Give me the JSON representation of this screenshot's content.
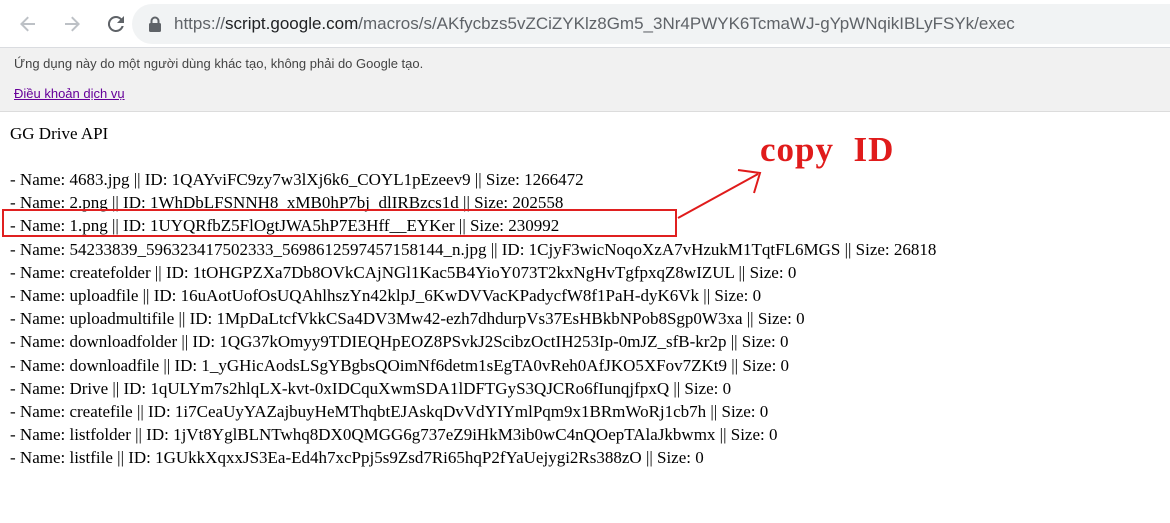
{
  "browser": {
    "url_scheme": "https://",
    "url_host": "script.google.com",
    "url_path": "/macros/s/AKfycbzs5vZCiZYKlz8Gm5_3Nr4PWYK6TcmaWJ-gYpWNqikIBLyFSYk/exec"
  },
  "banner": {
    "notice": "Ứng dụng này do một người dùng khác tạo, không phải do Google tạo.",
    "terms_link": "Điều khoản dịch vụ"
  },
  "page": {
    "title": "GG Drive API"
  },
  "files": [
    "- Name: 4683.jpg || ID: 1QAYviFC9zy7w3lXj6k6_COYL1pEzeev9 || Size: 1266472",
    "- Name: 2.png || ID: 1WhDbLFSNNH8_xMB0hP7bj_dlIRBzcs1d || Size: 202558",
    "- Name: 1.png || ID: 1UYQRfbZ5FlOgtJWA5hP7E3Hff__EYKer || Size: 230992",
    "- Name: 54233839_596323417502333_5698612597457158144_n.jpg || ID: 1CjyF3wicNoqoXzA7vHzukM1TqtFL6MGS || Size: 26818",
    "- Name: createfolder || ID: 1tOHGPZXa7Db8OVkCAjNGl1Kac5B4YioY073T2kxNgHvTgfpxqZ8wIZUL || Size: 0",
    "- Name: uploadfile || ID: 16uAotUofOsUQAhlhszYn42klpJ_6KwDVVacKPadycfW8f1PaH-dyK6Vk || Size: 0",
    "- Name: uploadmultifile || ID: 1MpDaLtcfVkkCSa4DV3Mw42-ezh7dhdurpVs37EsHBkbNPob8Sgp0W3xa || Size: 0",
    "- Name: downloadfolder || ID: 1QG37kOmyy9TDIEQHpEOZ8PSvkJ2ScibzOctIH253Ip-0mJZ_sfB-kr2p || Size: 0",
    "- Name: downloadfile || ID: 1_yGHicAodsLSgYBgbsQOimNf6detm1sEgTA0vReh0AfJKO5XFov7ZKt9 || Size: 0",
    "- Name: Drive || ID: 1qULYm7s2hlqLX-kvt-0xIDCquXwmSDA1lDFTGyS3QJCRo6fIunqjfpxQ || Size: 0",
    "- Name: createfile || ID: 1i7CeaUyYAZajbuyHeMThqbtEJAskqDvVdYIYmlPqm9x1BRmWoRj1cb7h || Size: 0",
    "- Name: listfolder || ID: 1jVt8YglBLNTwhq8DX0QMGG6g737eZ9iHkM3ib0wC4nQOepTAlaJkbwmx || Size: 0",
    "- Name: listfile || ID: 1GUkkXqxxJS3Ea-Ed4h7xcPpj5s9Zsd7Ri65hqP2fYaUejygi2Rs388zO || Size: 0"
  ],
  "annotation": {
    "text": "copy  ID",
    "color": "#e01b1b"
  }
}
